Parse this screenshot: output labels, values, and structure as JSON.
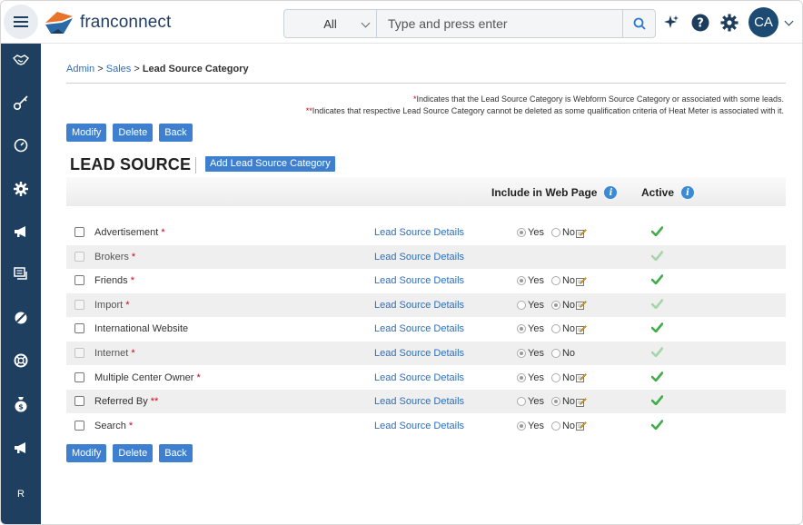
{
  "header": {
    "logo_text": "franconnect",
    "search": {
      "category": "All",
      "placeholder": "Type and press enter"
    },
    "avatar_initials": "CA",
    "icons": [
      "sparkle-icon",
      "help-icon",
      "settings-icon"
    ]
  },
  "sidebar": {
    "items": [
      {
        "icon": "handshake-icon"
      },
      {
        "icon": "key-icon"
      },
      {
        "icon": "gauge-icon"
      },
      {
        "icon": "gear-icon"
      },
      {
        "icon": "megaphone-icon"
      },
      {
        "icon": "chat-icon"
      },
      {
        "icon": "pill-icon"
      },
      {
        "icon": "lifebuoy-icon"
      },
      {
        "icon": "money-bag-icon"
      },
      {
        "icon": "megaphone-icon"
      },
      {
        "label": "R"
      }
    ]
  },
  "breadcrumb": {
    "admin": "Admin",
    "sep1": " > ",
    "sales": "Sales",
    "sep2": " > ",
    "current": "Lead Source Category"
  },
  "notes": {
    "note1_star": "*",
    "note1": "Indicates that the Lead Source Category is Webform Source Category or associated with some leads.",
    "note2_star": "**",
    "note2": "Indicates that respective Lead Source Category cannot be deleted as some qualification criteria of Heat Meter is associated with it."
  },
  "buttons": {
    "modify": "Modify",
    "delete": "Delete",
    "back": "Back",
    "add_category": "Add Lead Source Category"
  },
  "section_title": "LEAD SOURCE",
  "table": {
    "col_web": "Include in Web Page",
    "col_active": "Active",
    "details_label": "Lead Source Details",
    "yes": "Yes",
    "no": "No",
    "rows": [
      {
        "name": "Advertisement",
        "mark": "*",
        "web": "yes",
        "editable": true,
        "enabled": true,
        "active_strength": "strong"
      },
      {
        "name": "Brokers",
        "mark": "*",
        "web": "none",
        "editable": false,
        "enabled": false,
        "active_strength": "light"
      },
      {
        "name": "Friends",
        "mark": "*",
        "web": "yes",
        "editable": true,
        "enabled": true,
        "active_strength": "strong"
      },
      {
        "name": "Import",
        "mark": "*",
        "web": "no",
        "editable": true,
        "enabled": false,
        "active_strength": "light"
      },
      {
        "name": "International Website",
        "mark": "",
        "web": "yes",
        "editable": true,
        "enabled": true,
        "active_strength": "strong"
      },
      {
        "name": "Internet",
        "mark": "*",
        "web": "yes",
        "editable": false,
        "enabled": false,
        "active_strength": "light"
      },
      {
        "name": "Multiple Center Owner",
        "mark": "*",
        "web": "yes",
        "editable": true,
        "enabled": true,
        "active_strength": "strong"
      },
      {
        "name": "Referred By",
        "mark": "**",
        "web": "no",
        "editable": true,
        "enabled": true,
        "active_strength": "strong"
      },
      {
        "name": "Search",
        "mark": "*",
        "web": "yes",
        "editable": true,
        "enabled": true,
        "active_strength": "strong"
      }
    ]
  },
  "colors": {
    "sidebar": "#1e3f5f",
    "button": "#3e80cf",
    "link": "#2a6fbd",
    "required": "#d0021b",
    "check": "#3fae49"
  }
}
